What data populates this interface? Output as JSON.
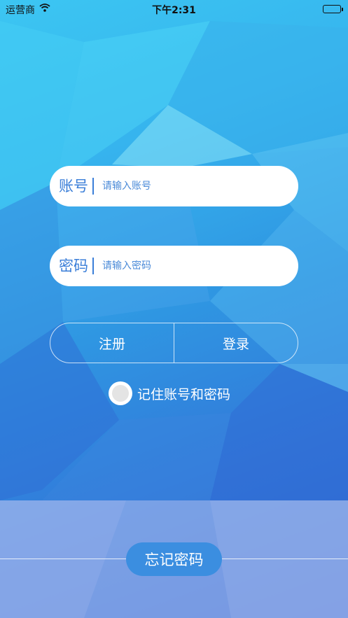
{
  "status_bar": {
    "carrier": "运营商",
    "time": "下午2:31"
  },
  "login": {
    "account_label": "账号",
    "account_placeholder": "请输入账号",
    "password_label": "密码",
    "password_placeholder": "请输入密码",
    "register_label": "注册",
    "login_label": "登录",
    "remember_label": "记住账号和密码",
    "remember_checked": false
  },
  "footer": {
    "forgot_label": "忘记密码"
  },
  "colors": {
    "accent": "#3b8ee0",
    "label_blue": "#3a7ed8"
  }
}
